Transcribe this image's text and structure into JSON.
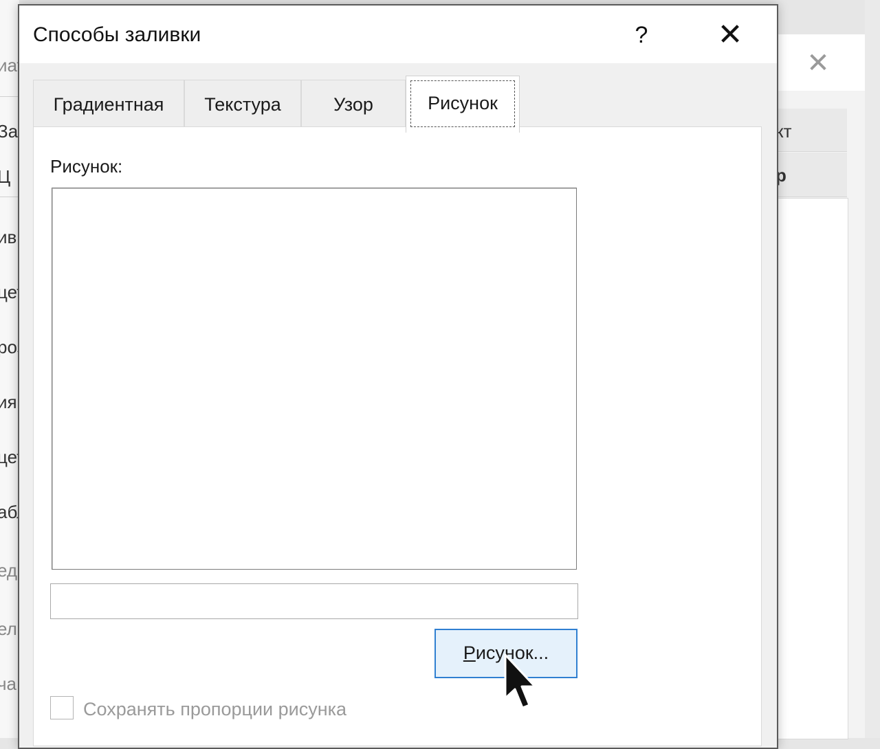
{
  "dialog": {
    "title": "Способы заливки",
    "help_label": "?",
    "close_label": "✕"
  },
  "tabs": [
    {
      "label": "Градиентная",
      "active": false
    },
    {
      "label": "Текстура",
      "active": false
    },
    {
      "label": "Узор",
      "active": false
    },
    {
      "label": "Рисунок",
      "active": true
    }
  ],
  "picture_panel": {
    "label": "Рисунок:",
    "filename_value": "",
    "select_button": {
      "mnemonic": "Р",
      "rest": "исунок..."
    },
    "lock_aspect": {
      "label": "Сохранять пропорции рисунка",
      "checked": false
    }
  },
  "background": {
    "close_label": "✕",
    "left_fragments": [
      "иат",
      "За",
      "Ц",
      "ивı",
      "цет",
      "роз",
      "ия",
      "цет",
      "абл",
      "ед",
      "елı",
      "ча"
    ],
    "right_fragments": [
      "кт",
      "р"
    ]
  },
  "colors": {
    "accent_border": "#2f7fd1",
    "button_fill": "#e5f1fb"
  }
}
